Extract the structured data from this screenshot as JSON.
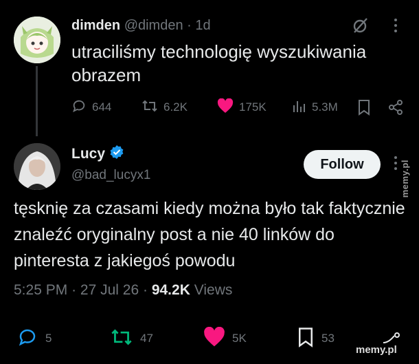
{
  "tweet1": {
    "display_name": "dimden",
    "handle": "@dimden",
    "separator": "·",
    "time": "1d",
    "text": "utraciliśmy technologię wyszukiwania obrazem",
    "replies": "644",
    "retweets": "6.2K",
    "likes": "175K",
    "views": "5.3M"
  },
  "tweet2": {
    "display_name": "Lucy",
    "handle": "@bad_lucyx1",
    "follow_label": "Follow",
    "text": "tęsknię za czasami kiedy można było tak faktycznie znaleźć oryginalny post a nie 40 linków do pinteresta z jakiegoś powodu",
    "time": "5:25 PM",
    "sep1": "·",
    "date": "27 Jul 26",
    "sep2": "·",
    "views_count": "94.2K",
    "views_label": "Views",
    "replies": "5",
    "retweets": "47",
    "likes": "5K",
    "bookmarks": "53"
  },
  "watermark": {
    "side": "memy.pl",
    "corner": "memy.pl"
  },
  "colors": {
    "background": "#000000",
    "text": "#e7e9ea",
    "muted": "#71767b",
    "like": "#f91880",
    "verified": "#1d9bf0",
    "follow_bg": "#eff3f4"
  },
  "icons": [
    "grok-icon",
    "more-icon",
    "reply-icon",
    "retweet-icon",
    "heart-icon",
    "views-icon",
    "bookmark-icon",
    "share-icon",
    "verified-badge-icon"
  ]
}
